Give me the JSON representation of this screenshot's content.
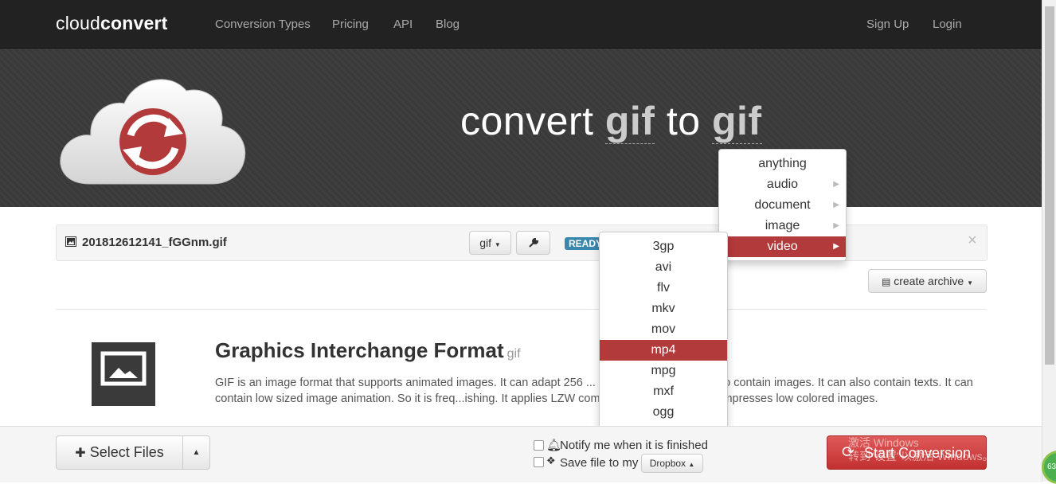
{
  "nav": {
    "brand_light": "cloud",
    "brand_bold": "convert",
    "links": [
      "Conversion Types",
      "Pricing",
      "API",
      "Blog"
    ],
    "sign_up": "Sign Up",
    "login": "Login"
  },
  "hero": {
    "convert": "convert",
    "from": "gif",
    "to_word": "to",
    "to": "gif"
  },
  "file": {
    "name": "201812612141_fGGnm.gif",
    "format_btn": "gif",
    "status": "READY",
    "close": "×"
  },
  "archive_btn": "create archive",
  "format_info": {
    "title": "Graphics Interchange Format",
    "ext": "gif",
    "description": "GIF is an image format that supports animated images. It can adapt 256 ... compression technique to contain images. It can also contain texts. It can contain low sized image animation. So it is freq...ishing. It applies LZW compression algorithm to compresses low colored images."
  },
  "category_menu": {
    "items": [
      "anything",
      "audio",
      "document",
      "image",
      "video"
    ],
    "active": "video"
  },
  "video_menu": {
    "items": [
      "3gp",
      "avi",
      "flv",
      "mkv",
      "mov",
      "mp4",
      "mpg",
      "mxf",
      "ogg"
    ],
    "active": "mp4"
  },
  "footer": {
    "select_files": "Select Files",
    "notify": "Notify me when it is finished",
    "save_to": "Save file to my",
    "dropbox": "Dropbox",
    "start": "Start Conversion",
    "watermark_line1": "激活 Windows",
    "watermark_line2": "转到\"设置\"以激活 Windows。",
    "badge": "63"
  },
  "colors": {
    "accent_red": "#b33a3a",
    "ready_blue": "#3a87ad",
    "navbar": "#222222"
  }
}
